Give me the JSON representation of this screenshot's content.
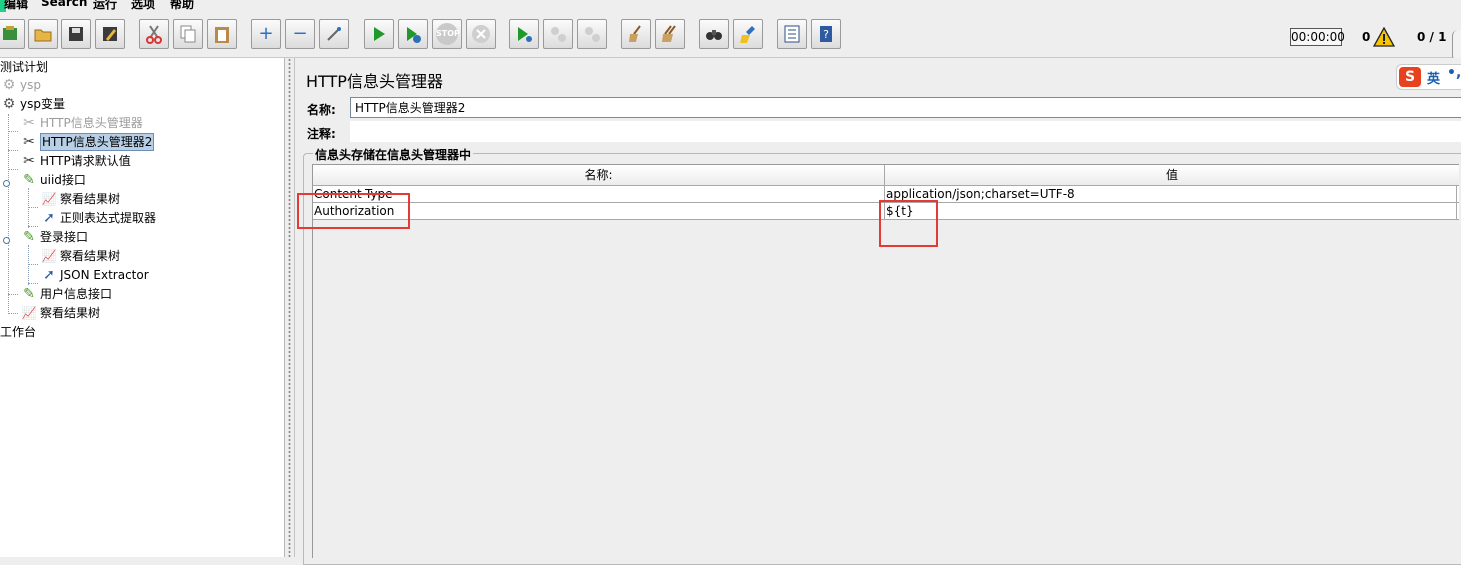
{
  "menu": [
    "编辑",
    "Search",
    "运行",
    "选项",
    "帮助"
  ],
  "toolbar": {
    "buttons": [
      {
        "name": "templates-button",
        "icon": "templates-icon"
      },
      {
        "name": "open-button",
        "icon": "folder-icon"
      },
      {
        "name": "save-button",
        "icon": "floppy-icon"
      },
      {
        "name": "save-as-button",
        "icon": "save-edit-icon"
      },
      {
        "name": "cut-button",
        "icon": "scissors-icon"
      },
      {
        "name": "copy-button",
        "icon": "copy-icon"
      },
      {
        "name": "paste-button",
        "icon": "clipboard-icon"
      },
      {
        "name": "expand-button",
        "icon": "plus-icon"
      },
      {
        "name": "collapse-button",
        "icon": "minus-icon"
      },
      {
        "name": "toggle-button",
        "icon": "wand-icon"
      },
      {
        "name": "start-button",
        "icon": "play-icon"
      },
      {
        "name": "start-no-pause-button",
        "icon": "play-timer-icon"
      },
      {
        "name": "stop-button",
        "icon": "stop-icon",
        "disabled": true,
        "text": "STOP"
      },
      {
        "name": "shutdown-button",
        "icon": "shutdown-icon",
        "disabled": true
      },
      {
        "name": "remote-start-button",
        "icon": "remote-play-icon"
      },
      {
        "name": "remote-stop-button",
        "icon": "remote-stop-icon",
        "disabled": true
      },
      {
        "name": "remote-shutdown-button",
        "icon": "remote-shutdown-icon",
        "disabled": true
      },
      {
        "name": "clear-button",
        "icon": "broom-icon"
      },
      {
        "name": "clear-all-button",
        "icon": "broom-all-icon"
      },
      {
        "name": "search-button",
        "icon": "binoculars-icon"
      },
      {
        "name": "reset-search-button",
        "icon": "brush-icon"
      },
      {
        "name": "function-helper-button",
        "icon": "list-icon"
      },
      {
        "name": "help-button",
        "icon": "help-book-icon"
      }
    ],
    "timer": "00:00:00",
    "error_count": "0",
    "threads": "0 / 1"
  },
  "tree": {
    "nodes": [
      {
        "label": "测试计划",
        "icon": "none",
        "dim": false,
        "selected": false
      },
      {
        "label": "ysp",
        "icon": "gear-icon",
        "dim": true,
        "selected": false
      },
      {
        "label": "ysp变量",
        "icon": "gear-icon",
        "dim": false,
        "selected": false
      },
      {
        "label": "HTTP信息头管理器",
        "icon": "wrench-icon",
        "dim": true,
        "selected": false
      },
      {
        "label": "HTTP信息头管理器2",
        "icon": "wrench-icon",
        "dim": false,
        "selected": true
      },
      {
        "label": "HTTP请求默认值",
        "icon": "wrench-icon",
        "dim": false,
        "selected": false
      },
      {
        "label": "uiid接口",
        "icon": "pipette-icon",
        "dim": false,
        "selected": false
      },
      {
        "label": "察看结果树",
        "icon": "graph-icon",
        "dim": false,
        "selected": false
      },
      {
        "label": "正则表达式提取器",
        "icon": "arrow-icon",
        "dim": false,
        "selected": false
      },
      {
        "label": "登录接口",
        "icon": "pipette-icon",
        "dim": false,
        "selected": false
      },
      {
        "label": "察看结果树",
        "icon": "graph-icon",
        "dim": false,
        "selected": false
      },
      {
        "label": "JSON Extractor",
        "icon": "arrow-icon",
        "dim": false,
        "selected": false
      },
      {
        "label": "用户信息接口",
        "icon": "pipette-icon",
        "dim": false,
        "selected": false
      },
      {
        "label": "察看结果树",
        "icon": "graph-icon",
        "dim": false,
        "selected": false
      },
      {
        "label": "工作台",
        "icon": "none",
        "dim": false,
        "selected": false
      }
    ]
  },
  "panel": {
    "title": "HTTP信息头管理器",
    "ime_text": "英",
    "name_label": "名称:",
    "name_value": "HTTP信息头管理器2",
    "comment_label": "注释:",
    "comment_value": "",
    "group_title": "信息头存储在信息头管理器中",
    "table": {
      "columns": [
        "名称:",
        "值"
      ],
      "rows": [
        [
          "Content-Type",
          "application/json;charset=UTF-8"
        ],
        [
          "Authorization",
          "${t}"
        ]
      ]
    }
  },
  "colors": {
    "accent_green": "#1fd089",
    "annotation_red": "#e53935",
    "selection_bg": "#b8cfe5"
  }
}
